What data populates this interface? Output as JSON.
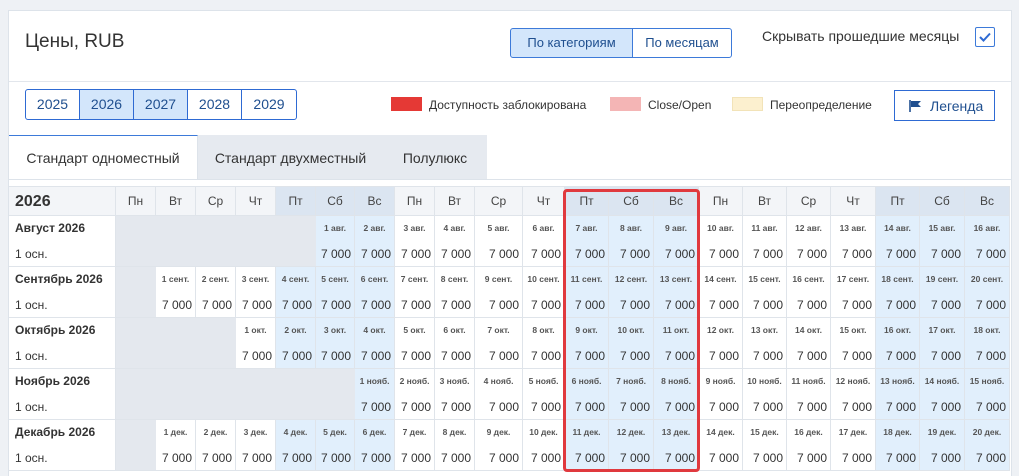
{
  "page": {
    "title": "Цены, RUB",
    "view_toggle": [
      "По категориям",
      "По месяцам"
    ],
    "hide_past_label": "Скрывать прошедшие месяцы",
    "hide_past_checked": true
  },
  "years": [
    "2025",
    "2026",
    "2027",
    "2028",
    "2029"
  ],
  "selected_years": [
    "2026",
    "2027"
  ],
  "legend": {
    "items": [
      {
        "label": "Доступность заблокирована",
        "color": "#e53935"
      },
      {
        "label": "Close/Open",
        "color": "#f4b5b5"
      },
      {
        "label": "Переопределение",
        "color": "#fcf0cf"
      }
    ],
    "button_label": "Легенда"
  },
  "tabs": [
    "Стандарт одноместный",
    "Стандарт двухместный",
    "Полулюкс"
  ],
  "grid": {
    "year": "2026",
    "day_names": [
      "Пн",
      "Вт",
      "Ср",
      "Чт",
      "Пт",
      "Сб",
      "Вс",
      "Пн",
      "Вт",
      "Ср",
      "Чт",
      "Пт",
      "Сб",
      "Вс",
      "Пн",
      "Вт",
      "Ср",
      "Чт",
      "Пт",
      "Сб",
      "Вс"
    ],
    "months": [
      {
        "name": "Август 2026",
        "sub": "1 осн.",
        "offset": 5,
        "labels": [
          "1 авг.",
          "2 авг.",
          "3 авг.",
          "4 авг.",
          "5 авг.",
          "6 авг.",
          "7 авг.",
          "8 авг.",
          "9 авг.",
          "10 авг.",
          "11 авг.",
          "12 авг.",
          "13 авг.",
          "14 авг.",
          "15 авг.",
          "16 авг."
        ],
        "prices": [
          "7 000",
          "7 000",
          "7 000",
          "7 000",
          "7 000",
          "7 000",
          "7 000",
          "7 000",
          "7 000",
          "7 000",
          "7 000",
          "7 000",
          "7 000",
          "7 000",
          "7 000",
          "7 000"
        ]
      },
      {
        "name": "Сентябрь 2026",
        "sub": "1 осн.",
        "offset": 1,
        "labels": [
          "1 сент.",
          "2 сент.",
          "3 сент.",
          "4 сент.",
          "5 сент.",
          "6 сент.",
          "7 сент.",
          "8 сент.",
          "9 сент.",
          "10 сент.",
          "11 сент.",
          "12 сент.",
          "13 сент.",
          "14 сент.",
          "15 сент.",
          "16 сент.",
          "17 сент.",
          "18 сент.",
          "19 сент.",
          "20 сент."
        ],
        "prices": [
          "7 000",
          "7 000",
          "7 000",
          "7 000",
          "7 000",
          "7 000",
          "7 000",
          "7 000",
          "7 000",
          "7 000",
          "7 000",
          "7 000",
          "7 000",
          "7 000",
          "7 000",
          "7 000",
          "7 000",
          "7 000",
          "7 000",
          "7 000"
        ]
      },
      {
        "name": "Октябрь 2026",
        "sub": "1 осн.",
        "offset": 3,
        "labels": [
          "1 окт.",
          "2 окт.",
          "3 окт.",
          "4 окт.",
          "5 окт.",
          "6 окт.",
          "7 окт.",
          "8 окт.",
          "9 окт.",
          "10 окт.",
          "11 окт.",
          "12 окт.",
          "13 окт.",
          "14 окт.",
          "15 окт.",
          "16 окт.",
          "17 окт.",
          "18 окт."
        ],
        "prices": [
          "7 000",
          "7 000",
          "7 000",
          "7 000",
          "7 000",
          "7 000",
          "7 000",
          "7 000",
          "7 000",
          "7 000",
          "7 000",
          "7 000",
          "7 000",
          "7 000",
          "7 000",
          "7 000",
          "7 000",
          "7 000"
        ]
      },
      {
        "name": "Ноябрь 2026",
        "sub": "1 осн.",
        "offset": 6,
        "labels": [
          "1 нояб.",
          "2 нояб.",
          "3 нояб.",
          "4 нояб.",
          "5 нояб.",
          "6 нояб.",
          "7 нояб.",
          "8 нояб.",
          "9 нояб.",
          "10 нояб.",
          "11 нояб.",
          "12 нояб.",
          "13 нояб.",
          "14 нояб.",
          "15 нояб."
        ],
        "prices": [
          "7 000",
          "7 000",
          "7 000",
          "7 000",
          "7 000",
          "7 000",
          "7 000",
          "7 000",
          "7 000",
          "7 000",
          "7 000",
          "7 000",
          "7 000",
          "7 000",
          "7 000"
        ]
      },
      {
        "name": "Декабрь 2026",
        "sub": "1 осн.",
        "offset": 1,
        "labels": [
          "1 дек.",
          "2 дек.",
          "3 дек.",
          "4 дек.",
          "5 дек.",
          "6 дек.",
          "7 дек.",
          "8 дек.",
          "9 дек.",
          "10 дек.",
          "11 дек.",
          "12 дек.",
          "13 дек.",
          "14 дек.",
          "15 дек.",
          "16 дек.",
          "17 дек.",
          "18 дек.",
          "19 дек.",
          "20 дек."
        ],
        "prices": [
          "7 000",
          "7 000",
          "7 000",
          "7 000",
          "7 000",
          "7 000",
          "7 000",
          "7 000",
          "7 000",
          "7 000",
          "7 000",
          "7 000",
          "7 000",
          "7 000",
          "7 000",
          "7 000",
          "7 000",
          "7 000",
          "7 000",
          "7 000"
        ]
      }
    ]
  },
  "colors": {
    "accent": "#2e6ad3",
    "weekday_cell": "#ffffff",
    "weekend_cell": "#e1effc",
    "empty_cell": "#e4e8ee",
    "highlight": "#e0393e"
  }
}
